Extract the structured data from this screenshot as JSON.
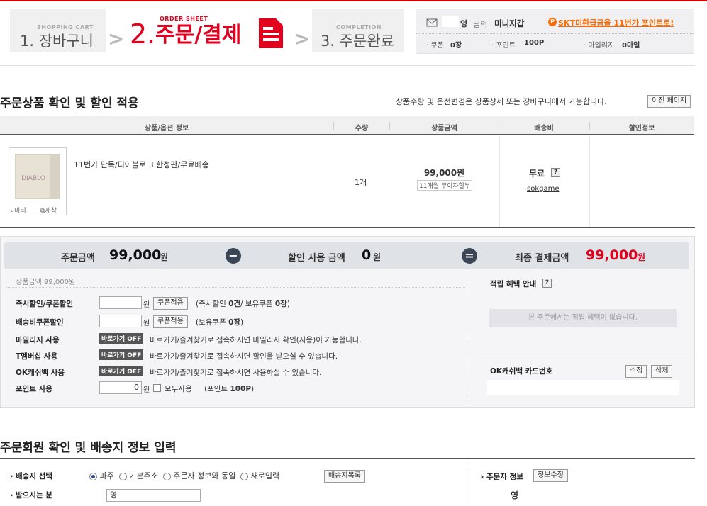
{
  "steps": {
    "s1_small": "SHOPPING CART",
    "s1_big": "1. 장바구니",
    "s2_small": "ORDER SHEET",
    "s2_num": "2.",
    "s2_big": "주문/결제",
    "s3_small": "COMPLETION",
    "s3_big": "3. 주문완료",
    "arrow": ">"
  },
  "member": {
    "name": "영",
    "suffix": "님의",
    "wallet": "미니지갑",
    "promo": "SKT미환급금을 11번가 포인트로!",
    "coupon_label": "· 쿠폰",
    "coupon_value": "0장",
    "point_label": "· 포인트",
    "point_value": "100P",
    "mileage_label": "· 마일리지",
    "mileage_value": "0마일"
  },
  "product_section": {
    "title": "주문상품 확인 및 할인 적용",
    "note": "상품수량 및 옵션변경은 상품상세 또는 장바구니에서 가능합니다.",
    "prev_button": "이전 페이지",
    "columns": [
      "상품/옵션 정보",
      "수량",
      "상품금액",
      "배송비",
      "할인정보"
    ],
    "item": {
      "name": "11번가 단독/디아블로 3 한정판/무료배송",
      "qty": "1개",
      "price": "99,000원",
      "installment": "11개월 무이자할부",
      "shipping": "무료",
      "seller": "sokgame",
      "zoom": "미리",
      "newwin": "새창"
    }
  },
  "summary": {
    "order_label": "주문금액",
    "order_value": "99,000",
    "won": "원",
    "minus": "−",
    "discount_label": "할인 사용 금액",
    "discount_value": "0",
    "equals": "=",
    "final_label": "최종 결제금액",
    "final_value": "99,000"
  },
  "options": {
    "goods_amount": "상품금액 99,000원",
    "rows": [
      {
        "label": "즉시할인/쿠폰할인",
        "unit": "원",
        "button": "쿠폰적용",
        "prefix": "(즉시할인 ",
        "count1": "0건",
        "mid": "/ 보유쿠폰 ",
        "count2": "0장",
        "suffix": ")"
      },
      {
        "label": "배송비쿠폰할인",
        "unit": "원",
        "button": "쿠폰적용",
        "prefix": "(보유쿠폰 ",
        "count1": "0장",
        "suffix": ")"
      },
      {
        "label": "마일리지 사용",
        "tag": "바로가기",
        "tag_off": "OFF",
        "desc": "바로가기/즐겨찾기로 접속하시면 마일리지 확인(사용)이 가능합니다."
      },
      {
        "label": "T멤버십 사용",
        "tag": "바로가기",
        "tag_off": "OFF",
        "desc": "바로가기/즐겨찾기로 접속하시면 할인을 받으실 수 있습니다."
      },
      {
        "label": "OK캐쉬백 사용",
        "tag": "바로가기",
        "tag_off": "OFF",
        "desc": "바로가기/즐겨찾기로 접속하시면 사용하실 수 있습니다."
      },
      {
        "label": "포인트 사용",
        "value": "0",
        "unit": "원",
        "all": "모두사용",
        "prefix": "(포인트 ",
        "points": "100P",
        "suffix": ")"
      }
    ],
    "benefit_title": "적립 혜택 안내",
    "benefit_note": "본 주문에서는 적립 혜택이 없습니다.",
    "okcash_label": "OK캐쉬백 카드번호",
    "edit": "수정",
    "delete": "삭제"
  },
  "delivery_section": {
    "title": "주문회원 확인 및 배송지 정보 입력",
    "dest_label": "배송지 선택",
    "radios": [
      "파주",
      "기본주소",
      "주문자 정보와 동일",
      "새로입력"
    ],
    "list_button": "배송지목록",
    "receiver_label": "받으시는 분",
    "receiver_value": "영",
    "orderer_label": "주문자 정보",
    "orderer_button": "정보수정",
    "orderer_name": "영"
  },
  "colors": {
    "accent": "#e1001e",
    "promo": "#ff6a00",
    "dark": "#3a4656"
  }
}
